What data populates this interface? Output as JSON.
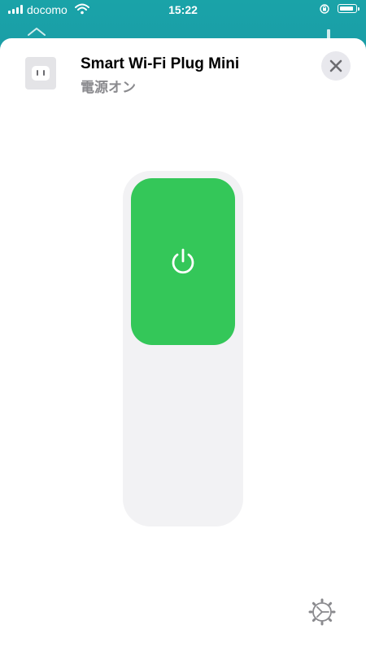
{
  "status_bar": {
    "carrier": "docomo",
    "time": "15:22",
    "battery_level": 0.9
  },
  "device": {
    "name": "Smart Wi-Fi Plug Mini",
    "status": "電源オン",
    "power_on": true
  },
  "icons": {
    "device": "outlet-icon",
    "close": "close-icon",
    "power": "power-icon",
    "settings": "gear-icon"
  },
  "colors": {
    "power_on": "#34c759",
    "track": "#f2f2f4",
    "close_bg": "#e8e8ed",
    "status_text": "#8a8a8e",
    "header_bg": "#1aa3a8"
  }
}
